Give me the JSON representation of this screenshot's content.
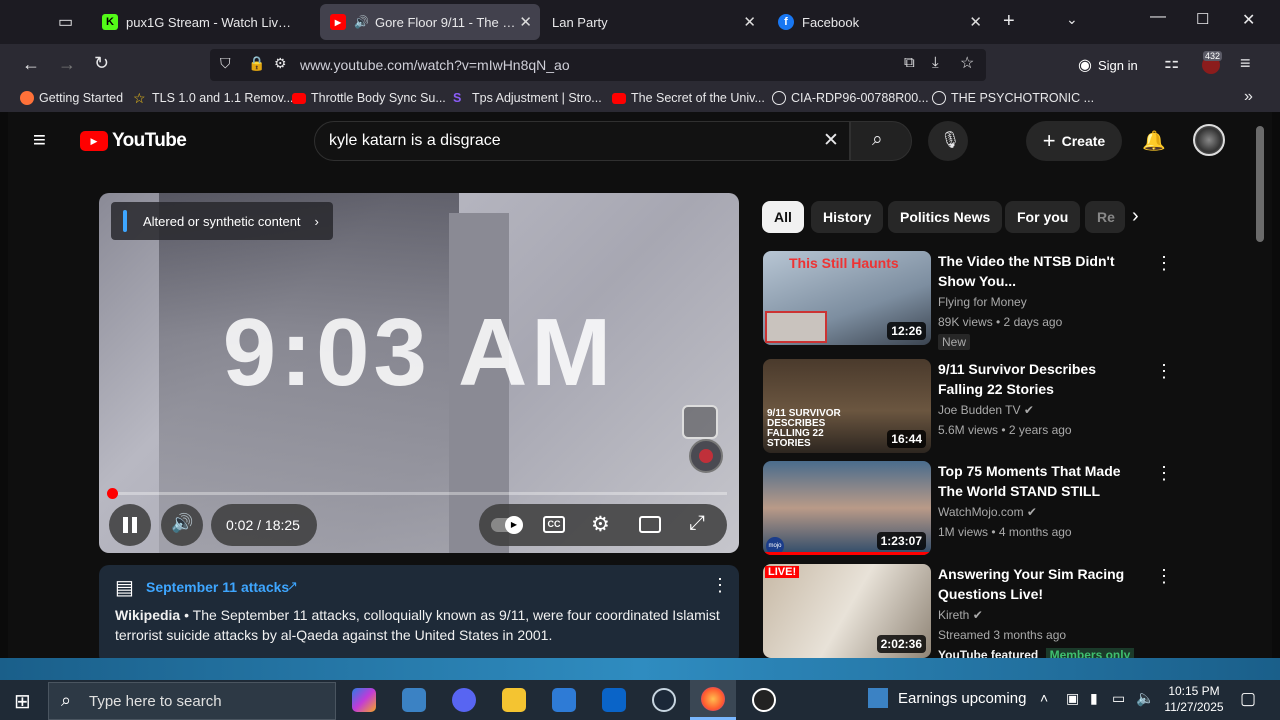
{
  "tabs": [
    {
      "title": "pux1G Stream - Watch Live on K",
      "favicon_color": "#53fc18",
      "favicon_letter": "K",
      "active": false
    },
    {
      "title": "Gore Floor 9/11 - The HOR",
      "favicon_color": "#ff0000",
      "favicon_letter": "▶",
      "active": true,
      "audio": true
    },
    {
      "title": "Lan Party",
      "favicon_color": "",
      "favicon_letter": "",
      "active": false
    },
    {
      "title": "Facebook",
      "favicon_color": "#1877f2",
      "favicon_letter": "f",
      "active": false
    }
  ],
  "url": "www.youtube.com/watch?v=mIwHn8qN_ao",
  "signin_label": "Sign in",
  "extension_badge": "432",
  "bookmarks": [
    {
      "label": "Getting Started",
      "icon_color": "#ff7139"
    },
    {
      "label": "TLS 1.0 and 1.1 Remov...",
      "icon_color": "#f5c518"
    },
    {
      "label": "Throttle Body Sync Su...",
      "icon_color": "#ff0000"
    },
    {
      "label": "Tps Adjustment | Stro...",
      "icon_color": "#8a5cf6"
    },
    {
      "label": "The Secret of the Univ...",
      "icon_color": "#ff0000"
    },
    {
      "label": "CIA-RDP96-00788R00...",
      "icon_color": "#e8e8ea"
    },
    {
      "label": "THE PSYCHOTRONIC ...",
      "icon_color": "#e8e8ea"
    }
  ],
  "youtube": {
    "logo_text": "YouTube",
    "search_query": "kyle katarn is a disgrace",
    "create_label": "Create",
    "player": {
      "overlay_text": "9:03 AM",
      "altered_label": "Altered or synthetic content",
      "time": "0:02 / 18:25",
      "progress": 0.002
    },
    "info_card": {
      "title": "September 11 attacks",
      "source": "Wikipedia",
      "text": "The September 11 attacks, colloquially known as 9/11, were four coordinated Islamist terrorist suicide attacks by al-Qaeda against the United States in 2001."
    },
    "chips": [
      "All",
      "History",
      "Politics News",
      "For you",
      "Re"
    ],
    "videos": [
      {
        "title": "The Video the NTSB Didn't Show You...",
        "channel": "Flying for Money",
        "meta": "89K views • 2 days ago",
        "badge": "New",
        "duration": "12:26",
        "thumb_text": "This Still Haunts"
      },
      {
        "title": "9/11 Survivor Describes Falling 22 Stories",
        "channel": "Joe Budden TV",
        "meta": "5.6M views • 2 years ago",
        "badge": "",
        "duration": "16:44",
        "thumb_text": "9/11 SURVIVOR DESCRIBES FALLING 22 STORIES"
      },
      {
        "title": "Top 75 Moments That Made The World STAND STILL",
        "channel": "WatchMojo.com",
        "meta": "1M views • 4 months ago",
        "badge": "",
        "duration": "1:23:07",
        "thumb_text": "mojo"
      },
      {
        "title": "Answering Your Sim Racing Questions Live!",
        "channel": "Kireth",
        "meta": "Streamed 3 months ago",
        "badge": "",
        "duration": "2:02:36",
        "thumb_text": "LIVE!",
        "extra": "YouTube featured",
        "members": "Members only"
      }
    ]
  },
  "taskbar": {
    "search_placeholder": "Type here to search",
    "widget": "Earnings upcoming",
    "time": "10:15 PM",
    "date": "11/27/2025"
  }
}
